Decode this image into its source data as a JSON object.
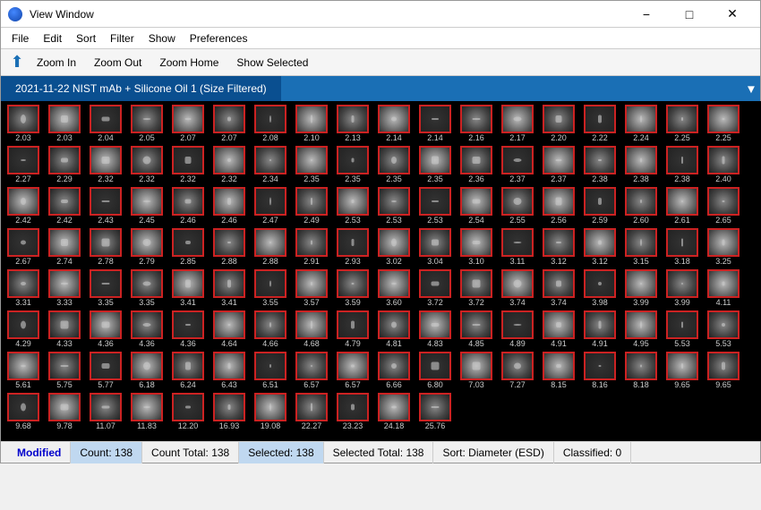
{
  "titleBar": {
    "icon": "app-icon",
    "title": "View Window",
    "minBtn": "−",
    "maxBtn": "□",
    "closeBtn": "✕"
  },
  "menuBar": {
    "items": [
      "File",
      "Edit",
      "Sort",
      "Filter",
      "Show",
      "Preferences"
    ]
  },
  "toolbar": {
    "backLabel": "↑",
    "buttons": [
      "Zoom In",
      "Zoom Out",
      "Zoom Home",
      "Show Selected"
    ]
  },
  "tab": {
    "label": "2021-11-22 NIST mAb + Silicone Oil 1 (Size Filtered)"
  },
  "particles": [
    "2.03",
    "2.03",
    "2.04",
    "2.05",
    "2.07",
    "2.07",
    "2.08",
    "2.10",
    "2.13",
    "2.14",
    "2.14",
    "2.16",
    "2.17",
    "2.20",
    "2.22",
    "2.24",
    "2.25",
    "2.25",
    "2.27",
    "2.29",
    "2.32",
    "2.32",
    "2.32",
    "2.32",
    "2.34",
    "2.35",
    "2.35",
    "2.35",
    "2.35",
    "2.36",
    "2.37",
    "2.37",
    "2.38",
    "2.38",
    "2.38",
    "2.40",
    "2.42",
    "2.42",
    "2.43",
    "2.45",
    "2.46",
    "2.46",
    "2.47",
    "2.49",
    "2.53",
    "2.53",
    "2.53",
    "2.54",
    "2.55",
    "2.56",
    "2.59",
    "2.60",
    "2.61",
    "2.65",
    "2.67",
    "2.74",
    "2.78",
    "2.79",
    "2.85",
    "2.88",
    "2.88",
    "2.91",
    "2.93",
    "3.02",
    "3.04",
    "3.10",
    "3.11",
    "3.12",
    "3.12",
    "3.15",
    "3.18",
    "3.25",
    "3.31",
    "3.33",
    "3.35",
    "3.35",
    "3.41",
    "3.41",
    "3.55",
    "3.57",
    "3.59",
    "3.60",
    "3.72",
    "3.72",
    "3.74",
    "3.74",
    "3.98",
    "3.99",
    "3.99",
    "4.11",
    "4.29",
    "4.33",
    "4.36",
    "4.36",
    "4.36",
    "4.64",
    "4.66",
    "4.68",
    "4.79",
    "4.81",
    "4.83",
    "4.85",
    "4.89",
    "4.91",
    "4.91",
    "4.95",
    "5.53",
    "5.53",
    "5.61",
    "5.75",
    "5.77",
    "6.18",
    "6.24",
    "6.43",
    "6.51",
    "6.57",
    "6.57",
    "6.66",
    "6.80",
    "7.03",
    "7.27",
    "8.15",
    "8.16",
    "8.18",
    "9.65",
    "9.65",
    "9.68",
    "9.78",
    "11.07",
    "11.83",
    "12.20",
    "16.93",
    "19.08",
    "22.27",
    "23.23",
    "24.18",
    "25.76"
  ],
  "statusBar": {
    "modified": "Modified",
    "count": "Count: 138",
    "countTotal": "Count Total: 138",
    "selected": "Selected: 138",
    "selectedTotal": "Selected Total: 138",
    "sort": "Sort:  Diameter (ESD)",
    "classified": "Classified: 0"
  }
}
